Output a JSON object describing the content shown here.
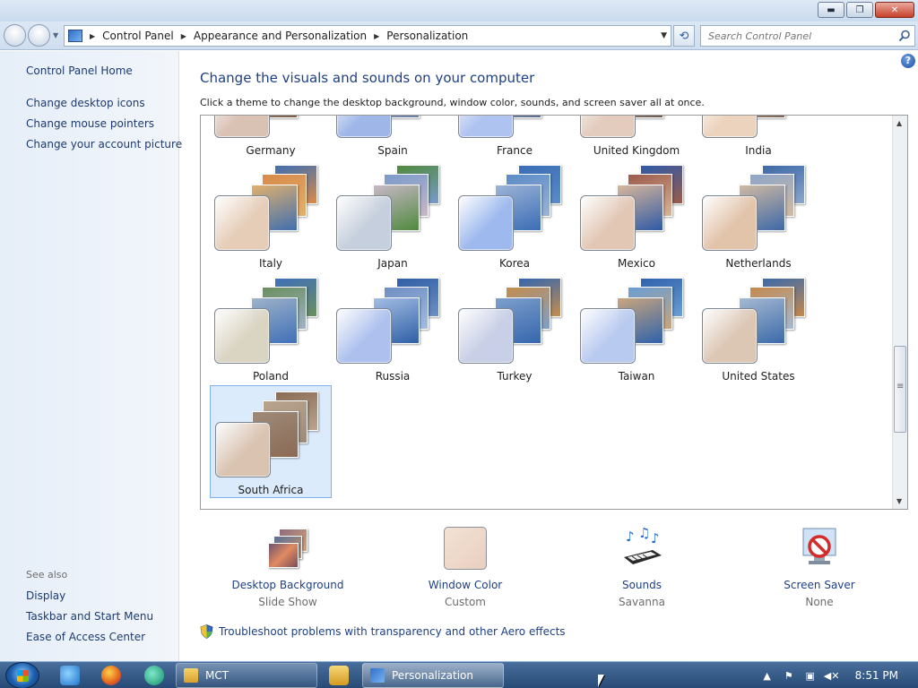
{
  "window": {
    "minimize": "▬",
    "maximize": "❐",
    "close": "✕"
  },
  "address": {
    "crumbs": [
      "Control Panel",
      "Appearance and Personalization",
      "Personalization"
    ],
    "search_placeholder": "Search Control Panel"
  },
  "sidebar": {
    "home": "Control Panel Home",
    "links": [
      "Change desktop icons",
      "Change mouse pointers",
      "Change your account picture"
    ],
    "see_also_label": "See also",
    "see_also": [
      "Display",
      "Taskbar and Start Menu",
      "Ease of Access Center"
    ]
  },
  "main": {
    "help": "?",
    "heading": "Change the visuals and sounds on your computer",
    "subtext": "Click a theme to change the desktop background, window color, sounds, and screen saver all at once."
  },
  "themes": [
    {
      "name": "Germany",
      "colors": [
        "#7a5a48",
        "#9aa4b3",
        "#c3b8a6"
      ],
      "swatch": "#d9c1b4"
    },
    {
      "name": "Spain",
      "colors": [
        "#6e7fa5",
        "#c89a70",
        "#8db0d8"
      ],
      "swatch": "#9fb7e8"
    },
    {
      "name": "France",
      "colors": [
        "#5a6d8d",
        "#b07a55",
        "#a8c0e0"
      ],
      "swatch": "#aec3ef"
    },
    {
      "name": "United Kingdom",
      "colors": [
        "#6d5a4e",
        "#b49d88",
        "#d9c0a9"
      ],
      "swatch": "#e3cbbd"
    },
    {
      "name": "India",
      "colors": [
        "#7b6353",
        "#c9ad8e",
        "#e7c6a4"
      ],
      "swatch": "#ecd3bd"
    },
    {
      "name": "Italy",
      "colors": [
        "#3f6fb0",
        "#d98a4a",
        "#e2b06d"
      ],
      "swatch": "#e6cdb8"
    },
    {
      "name": "Japan",
      "colors": [
        "#4f8a3e",
        "#7a9acb",
        "#c8b7c6"
      ],
      "swatch": "#c6cfdd"
    },
    {
      "name": "Korea",
      "colors": [
        "#3a6db5",
        "#5b8cc7",
        "#9cb3d6"
      ],
      "swatch": "#9db9ee"
    },
    {
      "name": "Mexico",
      "colors": [
        "#2f5aa6",
        "#9c5b4a",
        "#d8b69a"
      ],
      "swatch": "#e2c7b5"
    },
    {
      "name": "Netherlands",
      "colors": [
        "#3d69a8",
        "#8da6c9",
        "#d0b9a2"
      ],
      "swatch": "#e2c4aa"
    },
    {
      "name": "Poland",
      "colors": [
        "#3f70b8",
        "#6a8f5e",
        "#9fb2c8"
      ],
      "swatch": "#dad4c2"
    },
    {
      "name": "Russia",
      "colors": [
        "#2f5fa6",
        "#6e8fc2",
        "#a3bde3"
      ],
      "swatch": "#aec1ee"
    },
    {
      "name": "Turkey",
      "colors": [
        "#3566ad",
        "#c48d4f",
        "#7d9fcb"
      ],
      "swatch": "#c8cfe6"
    },
    {
      "name": "Taiwan",
      "colors": [
        "#2f62ab",
        "#6a9ed4",
        "#c9a57d"
      ],
      "swatch": "#b9caf0"
    },
    {
      "name": "United States",
      "colors": [
        "#3b6aa9",
        "#c4894d",
        "#a5b9d2"
      ],
      "swatch": "#dcc6b4"
    },
    {
      "name": "South Africa",
      "colors": [
        "#8a6a55",
        "#b9a58e",
        "#9e8a78"
      ],
      "swatch": "#dac3b1"
    }
  ],
  "settings": [
    {
      "name": "Desktop Background",
      "value": "Slide Show",
      "icon": "desktop-background-icon"
    },
    {
      "name": "Window Color",
      "value": "Custom",
      "icon": "window-color-icon",
      "color": "#f3e2d5"
    },
    {
      "name": "Sounds",
      "value": "Savanna",
      "icon": "sounds-icon"
    },
    {
      "name": "Screen Saver",
      "value": "None",
      "icon": "screen-saver-icon"
    }
  ],
  "troubleshoot": "Troubleshoot problems with transparency and other Aero effects",
  "taskbar": {
    "tasks": [
      "MCT",
      "Personalization"
    ],
    "clock": "8:51 PM"
  }
}
